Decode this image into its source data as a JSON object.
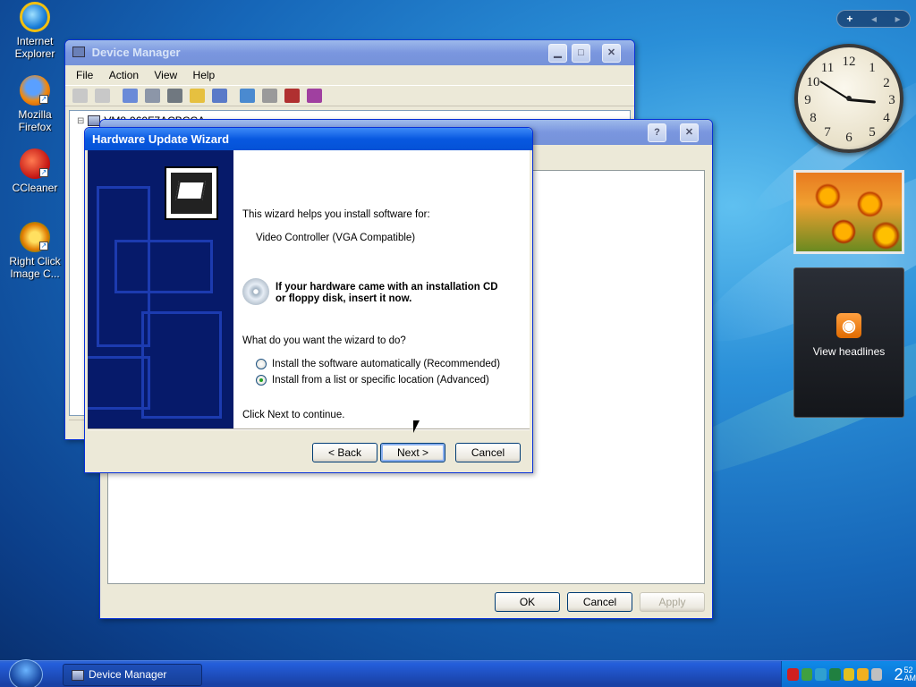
{
  "desktop": {
    "icons": [
      {
        "label_line1": "Internet",
        "label_line2": "Explorer",
        "icon": "internet-explorer-icon"
      },
      {
        "label_line1": "Mozilla",
        "label_line2": "Firefox",
        "icon": "firefox-icon"
      },
      {
        "label_line1": "CCleaner",
        "label_line2": "",
        "icon": "ccleaner-icon"
      },
      {
        "label_line1": "Right Click",
        "label_line2": "Image C...",
        "icon": "right-click-image-icon"
      }
    ]
  },
  "device_manager": {
    "title": "Device Manager",
    "menu": [
      "File",
      "Action",
      "View",
      "Help"
    ],
    "tree_root": "VM8-960F7ACBCCA"
  },
  "properties_window": {
    "ok_label": "OK",
    "cancel_label": "Cancel",
    "apply_label": "Apply"
  },
  "wizard": {
    "title": "Hardware Update Wizard",
    "intro": "This wizard helps you install software for:",
    "device_name": "Video Controller (VGA Compatible)",
    "cd_hint_line1": "If your hardware came with an installation CD",
    "cd_hint_line2": "or floppy disk, insert it now.",
    "question": "What do you want the wizard to do?",
    "options": [
      {
        "label": "Install the software automatically (Recommended)",
        "selected": false
      },
      {
        "label": "Install from a list or specific location (Advanced)",
        "selected": true
      }
    ],
    "continue_text": "Click Next to continue.",
    "back_label": "< Back",
    "next_label": "Next >",
    "cancel_label": "Cancel"
  },
  "gadgets": {
    "bar_add": "+",
    "clock_numbers": [
      "12",
      "1",
      "2",
      "3",
      "4",
      "5",
      "6",
      "7",
      "8",
      "9",
      "10",
      "11"
    ],
    "feed_label": "View headlines"
  },
  "taskbar": {
    "task_label": "Device Manager",
    "clock_hour": "2",
    "clock_minutes": "52",
    "clock_ampm": "AM"
  },
  "colors": {
    "title_active": "#0858e0",
    "title_inactive": "#7a96df",
    "taskbar": "#245edb",
    "wizard_banner": "#061a6a"
  }
}
